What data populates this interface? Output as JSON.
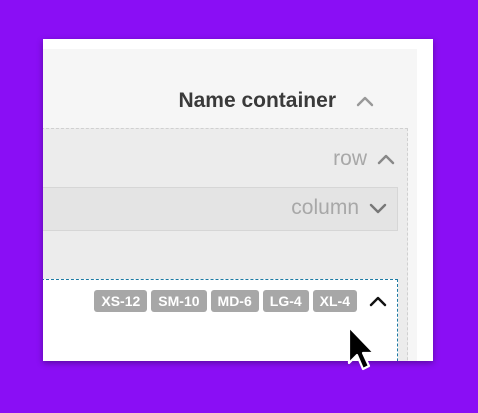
{
  "container": {
    "title": "Name container",
    "toggle_icon": "chevron-up-icon"
  },
  "row": {
    "label": "row",
    "toggle_icon": "chevron-up-icon"
  },
  "column": {
    "label": "column",
    "toggle_icon": "chevron-down-icon"
  },
  "item": {
    "badges": [
      "XS-12",
      "SM-10",
      "MD-6",
      "LG-4",
      "XL-4"
    ],
    "toggle_icon": "chevron-up-icon"
  },
  "cursor": {
    "icon": "mouse-pointer-icon"
  },
  "colors": {
    "background": "#8a0ef5",
    "selected_border": "#1c7aa3",
    "badge": "#a7a7a7"
  }
}
